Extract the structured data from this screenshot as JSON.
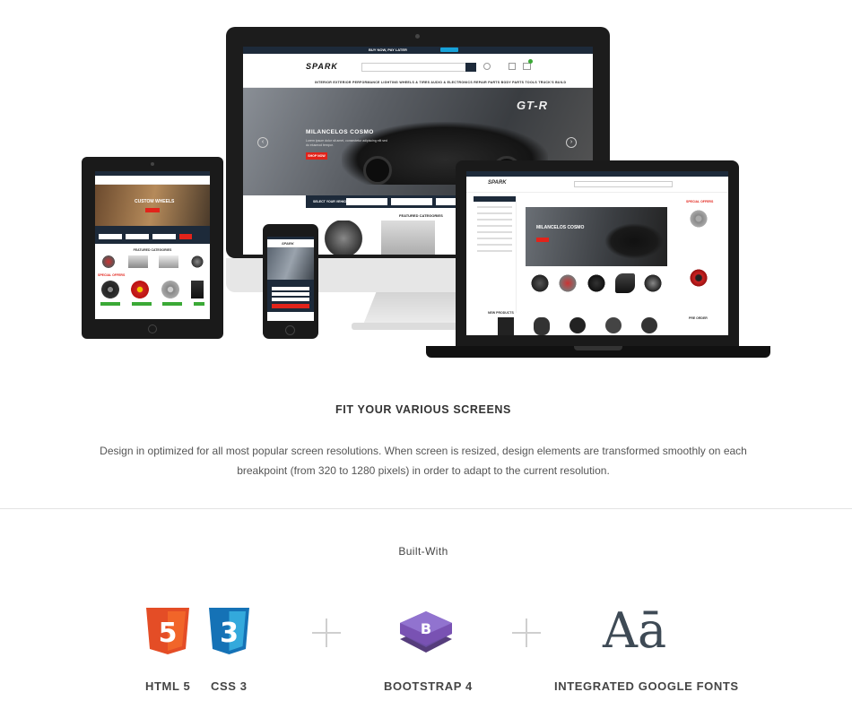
{
  "mockup": {
    "promo_text": "BUY NOW, PAY LATER",
    "logo": "SPARK",
    "nav": "INTERIOR   EXTERIOR   PERFORMANCE   LIGHTING   WHEELS & TIRES   AUDIO & ELECTRONICS   REPAIR PARTS   BODY PARTS   TOOLS   TRUCK'S BUILD",
    "hero_title": "MILANCELOS COSMO",
    "hero_text": "Lorem ipsum dolor sit amet, consectetur adipiscing elit sed do eiusmod tempor.",
    "hero_button": "SHOP NOW",
    "hero_badge": "GT-R",
    "vehicle_select": "SELECT YOUR VEHICLE",
    "featured": "FEATURED CATEGORIES",
    "tablet_hero": "CUSTOM WHEELS",
    "tablet_featured": "FEATURED CATEGORIES",
    "tablet_special": "SPECIAL OFFERS",
    "laptop_hero": "MILANCELOS COSMO",
    "laptop_special": "SPECIAL OFFERS",
    "laptop_new": "NEW PRODUCTS",
    "laptop_preorder": "PRE ORDER"
  },
  "section": {
    "title": "FIT YOUR VARIOUS SCREENS",
    "description": "Design in optimized for all most popular screen resolutions. When screen is resized, design elements are transformed smoothly on each breakpoint (from 320 to 1280 pixels) in order to adapt to the current resolution."
  },
  "built": {
    "title": "Built-With",
    "html_label": "HTML 5",
    "css_label": "CSS 3",
    "bootstrap_label": "BOOTSTRAP 4",
    "fonts_label": "INTEGRATED GOOGLE FONTS",
    "html_glyph": "5",
    "css_glyph": "3",
    "bootstrap_glyph": "B",
    "fonts_glyph": "Aā"
  },
  "colors": {
    "html_orange": "#e44d26",
    "css_blue": "#1572b6",
    "bootstrap_purple": "#7952b3",
    "brand_red": "#e2231a",
    "dark_navy": "#1d2a3a"
  }
}
